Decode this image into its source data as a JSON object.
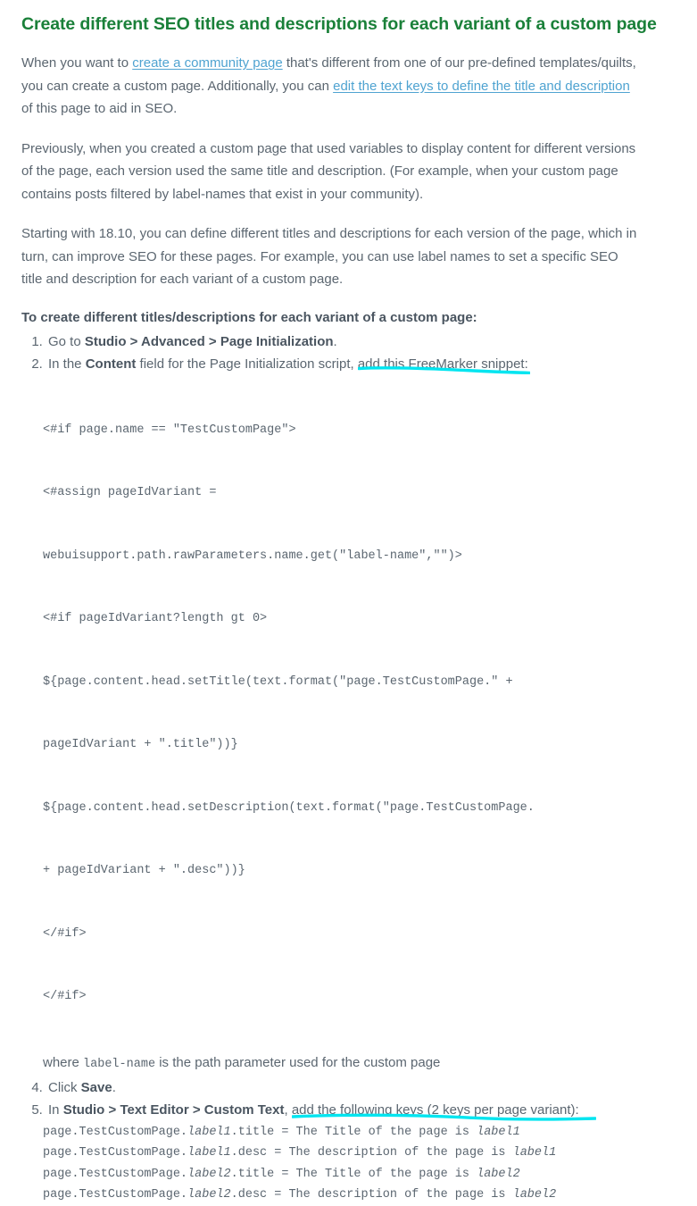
{
  "document": {
    "title": "Create different SEO titles and descriptions for each variant of a custom page",
    "paragraphs": {
      "p1_part1": "When you want to ",
      "p1_link1": "create a community page",
      "p1_part2": " that's different from one of our pre-defined templates/quilts, you can create a custom page. Additionally, you can ",
      "p1_link2": "edit the text keys to define the title and description",
      "p1_part3": " of this page to aid in SEO.",
      "p2": "Previously, when you created a custom page that used variables to display content for different versions of the page, each version used the same title and description. (For example, when your custom page contains posts filtered by label-names that exist in your community).",
      "p3": "Starting with 18.10, you can define different titles and descriptions for each version of the page, which in turn, can improve SEO for these pages. For example, you can use label names to set a specific SEO title and description for each variant of a custom page."
    },
    "steps_intro": "To create different titles/descriptions for each variant of a custom page:",
    "steps": {
      "step1": {
        "prefix": "Go to ",
        "bold": "Studio > Advanced > Page Initialization",
        "suffix": "."
      },
      "step2": {
        "prefix": "In the ",
        "bold": "Content",
        "mid": " field for the Page Initialization script, ",
        "highlighted": "add this FreeMarker snippet:"
      },
      "step3": {
        "prefix": "Click ",
        "bold": "Save",
        "suffix": "."
      },
      "step4": {
        "prefix": "In ",
        "bold1": "Studio > Text Editor > Custom Text",
        "mid": ", ",
        "highlighted": "add the following keys (2 keys per page variant):"
      }
    },
    "code_snippet": {
      "line1": "<#if page.name == \"TestCustomPage\">",
      "line2": "<#assign pageIdVariant =",
      "line3": "webuisupport.path.rawParameters.name.get(\"label-name\",\"\")>",
      "line4": "<#if pageIdVariant?length gt 0>",
      "line5": "${page.content.head.setTitle(text.format(\"page.TestCustomPage.\" +",
      "line6": "pageIdVariant + \".title\"))}",
      "line7": "${page.content.head.setDescription(text.format(\"page.TestCustomPage.",
      "line8": "+ pageIdVariant + \".desc\"))}",
      "line9": "</#if>",
      "line10": "</#if>"
    },
    "code_note": {
      "prefix": "where ",
      "mono": "label-name",
      "suffix": " is the path parameter used for the custom page"
    },
    "keys": {
      "k1_a": "page.TestCustomPage.",
      "k1_italic": "label1",
      "k1_b": ".title = The Title of the page is ",
      "k1_italic2": "label1",
      "k2_a": "page.TestCustomPage.",
      "k2_italic": "label1",
      "k2_b": ".desc = The description of the page is",
      "k2_italic2": "label1",
      "k3_a": "page.TestCustomPage.",
      "k3_italic": "label2",
      "k3_b": ".title = The Title of the page is ",
      "k3_italic2": "label2",
      "k4_a": "page.TestCustomPage.",
      "k4_italic": "label2",
      "k4_b": ".desc = The description of the page is",
      "k4_italic2": "label2"
    }
  },
  "colors": {
    "heading_green": "#1a8039",
    "link_blue": "#4fa3d1",
    "body_gray": "#5b6670",
    "highlight_cyan": "#00e5f0",
    "background": "#ffffff"
  }
}
